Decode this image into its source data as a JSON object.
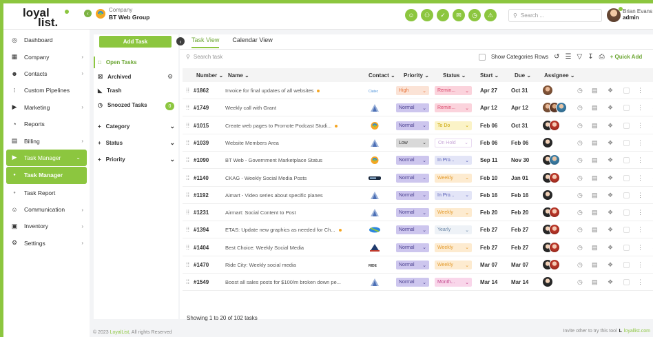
{
  "colors": {
    "brand": "#8cc63f",
    "priority_high": "#f9dcd0",
    "priority_normal": "#c9c2ec",
    "priority_low": "#d7d7d7"
  },
  "header": {
    "company_label": "Company",
    "company_name": "BT Web Group",
    "icons": [
      "user-icon",
      "users-icon",
      "check-square-icon",
      "message-icon",
      "clock-icon",
      "alert-icon"
    ],
    "search_placeholder": "Search ...",
    "user_name": "Brian  Evans",
    "user_role": "admin"
  },
  "sidebar": {
    "items": [
      {
        "label": "Dashboard",
        "icon": "dashboard-icon"
      },
      {
        "label": "Company",
        "icon": "building-icon"
      },
      {
        "label": "Contacts",
        "icon": "contacts-icon"
      },
      {
        "label": "Custom Pipelines",
        "icon": "pipeline-icon"
      },
      {
        "label": "Marketing",
        "icon": "megaphone-icon"
      },
      {
        "label": "Reports",
        "icon": "reports-icon"
      },
      {
        "label": "Billing",
        "icon": "billing-icon"
      },
      {
        "label": "Task Manager",
        "icon": "task-icon"
      },
      {
        "label": "Task Manager",
        "icon": "dot-icon"
      },
      {
        "label": "Task Report",
        "icon": "dot-icon"
      },
      {
        "label": "Communication",
        "icon": "communication-icon"
      },
      {
        "label": "Inventory",
        "icon": "inventory-icon"
      },
      {
        "label": "Settings",
        "icon": "settings-icon"
      }
    ]
  },
  "filter_panel": {
    "add_task": "Add Task",
    "open_tasks": "Open Tasks",
    "archived": "Archived",
    "trash": "Trash",
    "snoozed": "Snoozed Tasks",
    "snoozed_count": "0",
    "category": "Category",
    "status": "Status",
    "priority": "Priority"
  },
  "main": {
    "tabs": [
      "Task View",
      "Calendar View"
    ],
    "search_placeholder": "Search task",
    "show_categories": "Show Categories Rows",
    "quick_add": "+ Quick Add",
    "columns": [
      "Number",
      "Name",
      "Contact",
      "Priority",
      "Status",
      "Start",
      "Due",
      "Assignee"
    ],
    "showing": "Showing 1 to 20 of 102 tasks"
  },
  "tasks": [
    {
      "number": "#1862",
      "name": "Invoice for final updates of all websites",
      "flag": true,
      "contact": "logo-a",
      "priority": "High",
      "status": "Remin...",
      "start": "Apr 27",
      "due": "Oct 31",
      "assignees": [
        "av1"
      ]
    },
    {
      "number": "#1749",
      "name": "Weekly call with Grant",
      "flag": false,
      "contact": "logo-b",
      "priority": "Normal",
      "status": "Remin...",
      "start": "Apr 12",
      "due": "Apr 12",
      "assignees": [
        "av1",
        "av2",
        "av3"
      ]
    },
    {
      "number": "#1015",
      "name": "Create web pages to Promote Podcast Studi...",
      "flag": true,
      "contact": "logo-c",
      "priority": "Normal",
      "status": "To Do",
      "start": "Feb 06",
      "due": "Oct 31",
      "assignees": [
        "av4",
        "av5"
      ]
    },
    {
      "number": "#1039",
      "name": "Website Members Area",
      "flag": false,
      "contact": "logo-b",
      "priority": "Low",
      "status": "On Hold",
      "start": "Feb 06",
      "due": "Feb 06",
      "assignees": [
        "av4"
      ]
    },
    {
      "number": "#1090",
      "name": "BT Web - Government Marketplace Status",
      "flag": false,
      "contact": "logo-c",
      "priority": "Normal",
      "status": "In Pro...",
      "start": "Sep 11",
      "due": "Nov 30",
      "assignees": [
        "av4",
        "av3"
      ]
    },
    {
      "number": "#1140",
      "name": "CKAG - Weekly Social Media Posts",
      "flag": false,
      "contact": "logo-d",
      "priority": "Normal",
      "status": "Weekly",
      "start": "Feb 10",
      "due": "Jan 01",
      "assignees": [
        "av4",
        "av5"
      ]
    },
    {
      "number": "#1192",
      "name": "Aimart - Video series about specific planes",
      "flag": false,
      "contact": "logo-b",
      "priority": "Normal",
      "status": "In Pro...",
      "start": "Feb 16",
      "due": "Feb 16",
      "assignees": [
        "av4"
      ]
    },
    {
      "number": "#1231",
      "name": "Airmart: Social Content to Post",
      "flag": false,
      "contact": "logo-b",
      "priority": "Normal",
      "status": "Weekly",
      "start": "Feb 20",
      "due": "Feb 20",
      "assignees": [
        "av4",
        "av5"
      ]
    },
    {
      "number": "#1394",
      "name": "ETAS: Update new graphics as needed for Ch...",
      "flag": true,
      "contact": "logo-e",
      "priority": "Normal",
      "status": "Yearly",
      "start": "Feb 27",
      "due": "Feb 27",
      "assignees": [
        "av4",
        "av5"
      ]
    },
    {
      "number": "#1404",
      "name": "Best Choice: Weekly Social Media",
      "flag": false,
      "contact": "logo-f",
      "priority": "Normal",
      "status": "Weekly",
      "start": "Feb 27",
      "due": "Feb 27",
      "assignees": [
        "av4",
        "av5"
      ]
    },
    {
      "number": "#1470",
      "name": "Ride City: Weekly social media",
      "flag": false,
      "contact": "logo-g",
      "priority": "Normal",
      "status": "Weekly",
      "start": "Mar 07",
      "due": "Mar 07",
      "assignees": [
        "av4",
        "av5"
      ]
    },
    {
      "number": "#1549",
      "name": "Boost all sales posts for $100/m broken down pe...",
      "flag": false,
      "contact": "logo-b",
      "priority": "Normal",
      "status": "Month...",
      "start": "Mar 14",
      "due": "Mar 14",
      "assignees": [
        "av4"
      ]
    }
  ],
  "footer": {
    "copyright_prefix": "© 2023 ",
    "copyright_brand": "LoyalList",
    "copyright_suffix": ", All rights Reserved",
    "invite": "Invite other to try this tool",
    "invite_link": "loyallist.com"
  }
}
